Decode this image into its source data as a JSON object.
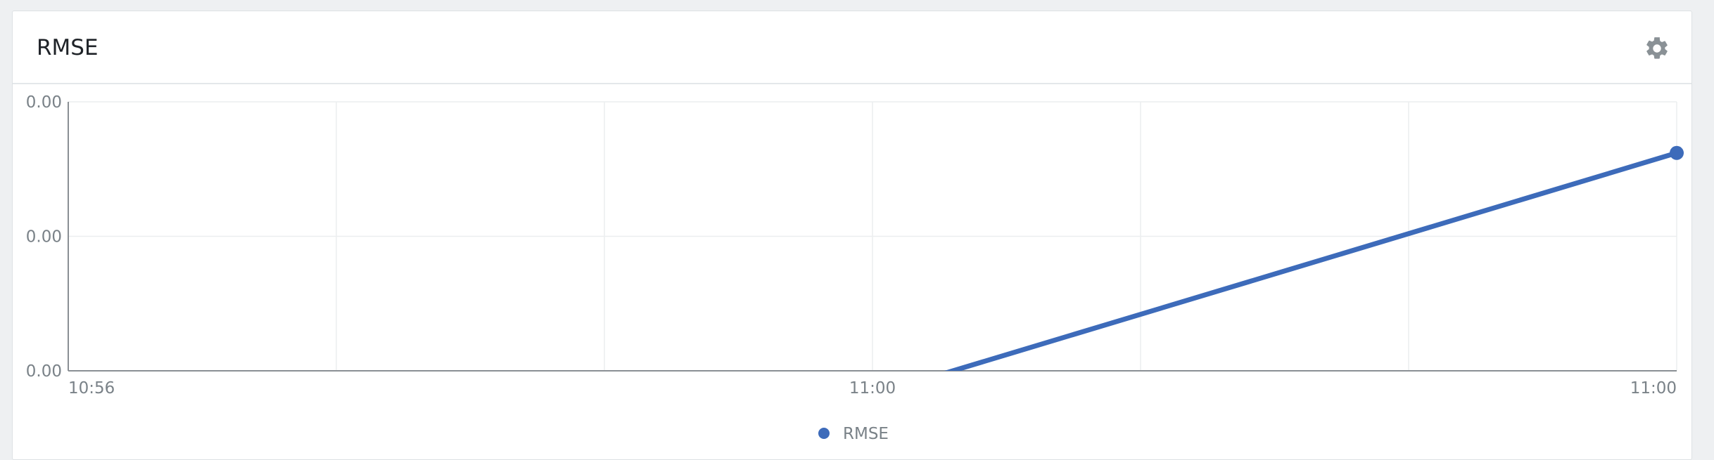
{
  "panel": {
    "title": "RMSE",
    "settings_icon": "gear-icon"
  },
  "colors": {
    "series": "#3d6bba",
    "grid": "#eceeef",
    "axis": "#8a8f94",
    "text": "#7a8288"
  },
  "chart_data": {
    "type": "line",
    "title": "",
    "xlabel": "",
    "ylabel": "",
    "y_tick_labels": [
      "0.00",
      "0.00",
      "0.00"
    ],
    "x_tick_labels": [
      "10:56",
      "11:00",
      "11:00"
    ],
    "series": [
      {
        "name": "RMSE",
        "points": [
          {
            "x": 0.55,
            "y": 0.0
          },
          {
            "x": 1.0,
            "y": 0.81
          }
        ]
      }
    ],
    "xlim": [
      0,
      1
    ],
    "ylim": [
      0,
      1
    ],
    "grid": true,
    "legend": "bottom-center"
  }
}
